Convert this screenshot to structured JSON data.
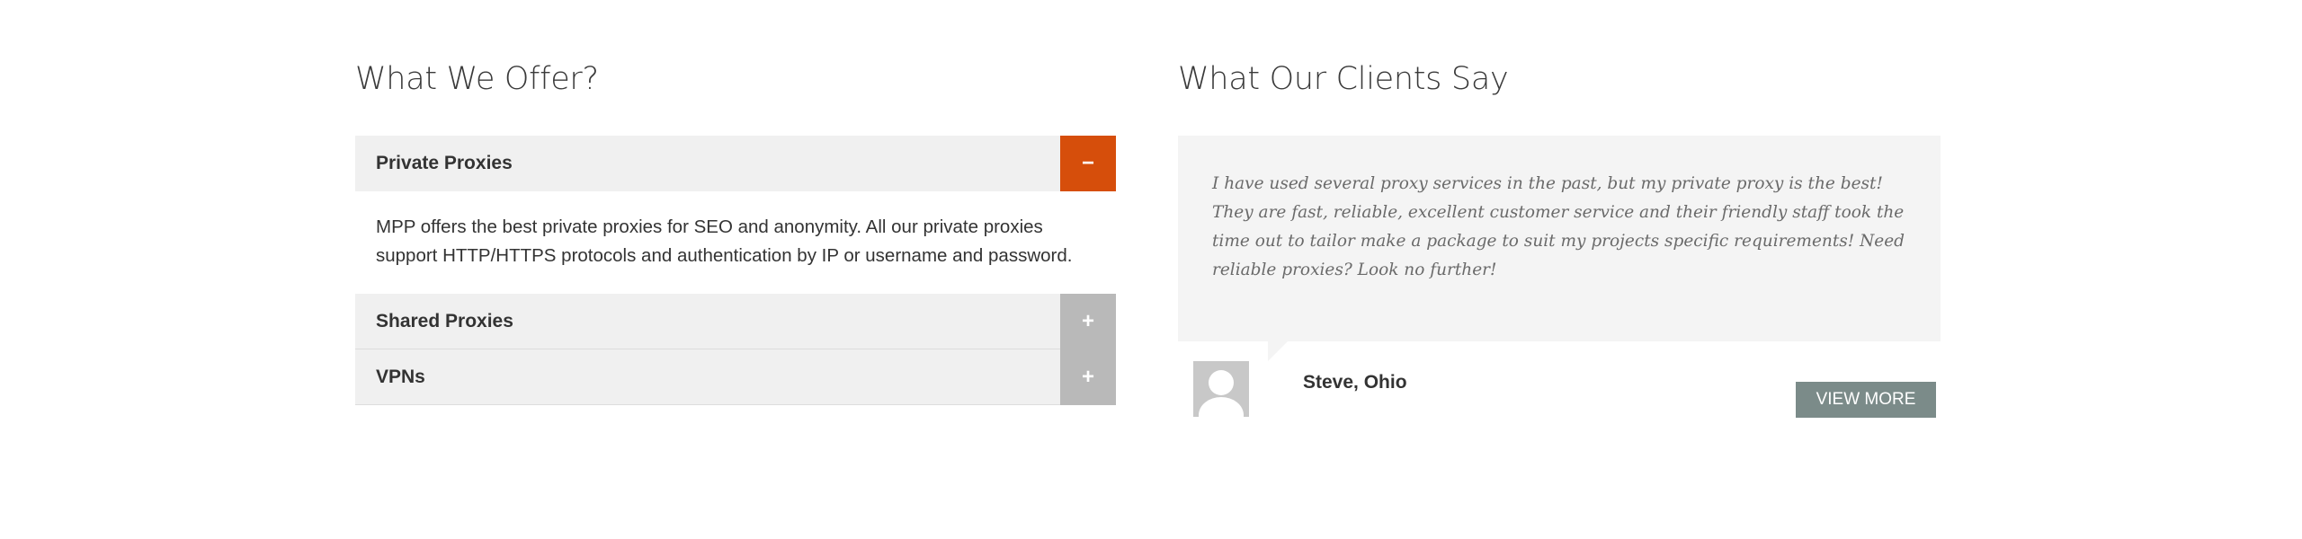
{
  "offer": {
    "title": "What We Offer?",
    "items": [
      {
        "label": "Private Proxies",
        "toggle": "−",
        "expanded": true,
        "body": "MPP offers the best private proxies for SEO and anonymity. All our private proxies support HTTP/HTTPS protocols and authentication by IP or username and password."
      },
      {
        "label": "Shared Proxies",
        "toggle": "+",
        "expanded": false
      },
      {
        "label": "VPNs",
        "toggle": "+",
        "expanded": false
      }
    ]
  },
  "clients": {
    "title": "What Our Clients Say",
    "testimonial": "I have used several proxy services in the past, but my private proxy is the best! They are fast, reliable, excellent customer service and their friendly staff took the time out to tailor make a package to suit my projects specific requirements! Need reliable proxies? Look no further!",
    "author": "Steve, Ohio",
    "view_more": "VIEW MORE"
  },
  "colors": {
    "accent_active": "#d64e0b",
    "toggle_inactive": "#b9b9b9",
    "button": "#7b8b89",
    "panel_bg": "#f0f0f0"
  },
  "icons": {
    "avatar": "user-silhouette-icon"
  }
}
